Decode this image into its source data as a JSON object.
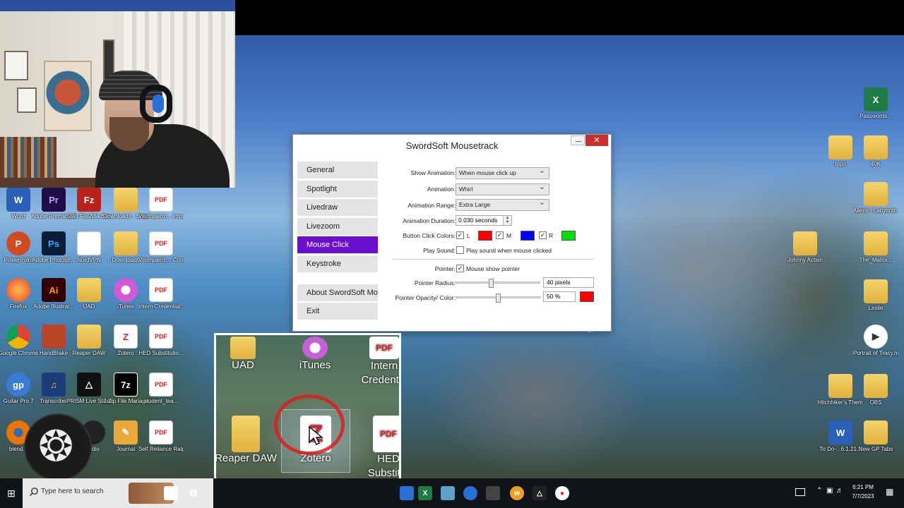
{
  "desktop_icons": {
    "word": "Word",
    "premiere": "Adobe Premiere P...",
    "filezilla": "Start FileZilla Server",
    "downloads_shortcut": "Downloads - Shortcut",
    "vis_important": "VisImpairm... Important!...",
    "powerpoint": "PowerPoint",
    "photoshop": "Adobe Photosh...",
    "nordvpn": "NordVPN",
    "downloads": "Downloads",
    "vis_conditions": "VisImpairm... Conditions...",
    "firefox": "Firefox",
    "illustrator": "Adobe Illustrat...",
    "uad": "UAD",
    "itunes": "iTunes",
    "intern_credential": "Intern Credential...",
    "chrome": "Google Chrome",
    "handbrake": "HandBrake",
    "reaper": "Reaper DAW",
    "zotero": "Zotero",
    "hed": "HED Substitutio...",
    "guitar_pro": "Guitar Pro 7",
    "transcribe": "Transcribe!",
    "prism": "PRISM Live Studio",
    "sevenzip": "7-Zip File Manager",
    "student_tea": "student_tea...",
    "blender": "blend...",
    "obs_audio": "...dio",
    "journal": "Journal",
    "self_reliance": "Self Reliance Ralph Wal...",
    "passwords": "Passwords...",
    "ippo": "Ippo",
    "forty_k": "40K",
    "aliens": "Aliens - Labyrinth ...",
    "johnny": "Johnny Action",
    "matrix": "The_Matrix...",
    "leslie": "Leslie",
    "portrait": "Portrait of Tracy.mp3",
    "hitchhiker": "Hitchhiker's Theme",
    "obs": "OBS",
    "todo": "To Do-...6.1.21...",
    "new_gp_tabs": "New GP Tabs"
  },
  "window": {
    "title": "SwordSoft Mousetrack",
    "nav": [
      "General",
      "Spotlight",
      "Livedraw",
      "Livezoom",
      "Mouse Click",
      "Keystroke"
    ],
    "nav_bottom": [
      "About SwordSoft Mousetrack",
      "Exit"
    ],
    "active_nav": "Mouse Click",
    "settings": {
      "show_animation_label": "Show Animation:",
      "show_animation_value": "When mouse click up",
      "animation_label": "Animation:",
      "animation_value": "Whirl",
      "animation_range_label": "Animation Range:",
      "animation_range_value": "Extra Large",
      "animation_duration_label": "Animation Duration:",
      "animation_duration_value": "0.030  seconds",
      "button_click_colors_label": "Button Click Colors:",
      "left_label": "L",
      "middle_label": "M",
      "right_label": "R",
      "left_color": "#ff0000",
      "middle_color": "#0000ff",
      "right_color": "#00dd00",
      "play_sound_label": "Play Sound:",
      "play_sound_text": "Play sound when mouse clicked",
      "play_sound_checked": false,
      "pointer_label": "Pointer:",
      "pointer_text": "Mouse show pointer",
      "pointer_checked": true,
      "pointer_radius_label": "Pointer Radius:",
      "pointer_radius_value": "40  pixels",
      "pointer_radius_level": 0.42,
      "pointer_opacity_label": "Pointer Opacity/ Color:",
      "pointer_opacity_value": "50  %",
      "pointer_opacity_level": 0.5,
      "pointer_color": "#ff0000"
    }
  },
  "zoom_inset": {
    "uad": "UAD",
    "itunes": "iTunes",
    "intern": "Intern Credentia",
    "reaper": "Reaper DAW",
    "zotero": "Zotero",
    "hed": "HED Substitut"
  },
  "taskbar": {
    "search_placeholder": "Type here to search",
    "time": "6:21 PM",
    "date": "7/7/2023"
  }
}
